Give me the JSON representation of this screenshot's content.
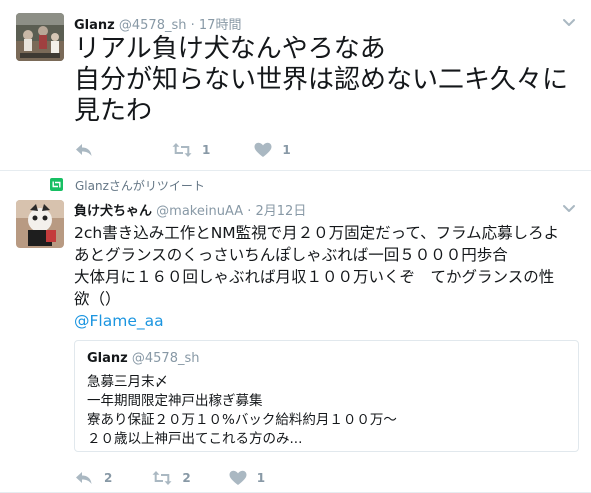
{
  "tweets": [
    {
      "author_name": "Glanz",
      "handle": "@4578_sh",
      "separator": "·",
      "time": "17時間",
      "text_lines": [
        "リアル負け犬なんやろなあ",
        "自分が知らない世界は認めない二キ久々に",
        "見たわ"
      ],
      "retweet_count": "1",
      "like_count": "1"
    },
    {
      "retweet_context": "Glanzさんがリツイート",
      "author_name": "負け犬ちゃん",
      "handle": "@makeinuAA",
      "separator": "·",
      "time": "2月12日",
      "text_lines": [
        "2ch書き込み工作とNM監視で月２０万固定だって、フラム応募しろよ",
        "あとグランスのくっさいちんぽしゃぶれば一回５０００円歩合",
        "大体月に１６０回しゃぶれば月収１００万いくぞ　てかグランスの性",
        "欲（）"
      ],
      "mention": "@Flame_aa",
      "quote": {
        "author_name": "Glanz",
        "handle": "@4578_sh",
        "text_lines": [
          "急募三月末〆",
          "一年期間限定神戸出稼ぎ募集",
          "寮あり保証２０万１０%バック給料約月１００万〜",
          "２０歳以上神戸出てこれる方のみ..."
        ]
      },
      "reply_count": "2",
      "retweet_count": "2",
      "like_count": "1"
    }
  ],
  "colors": {
    "icon_gray": "#aab8c2",
    "retweet_green": "#17bf63",
    "link_blue": "#1b95e0",
    "divider": "#e6ecf0"
  },
  "icons": [
    "reply-icon",
    "retweet-icon",
    "heart-icon",
    "chevron-down-icon"
  ]
}
